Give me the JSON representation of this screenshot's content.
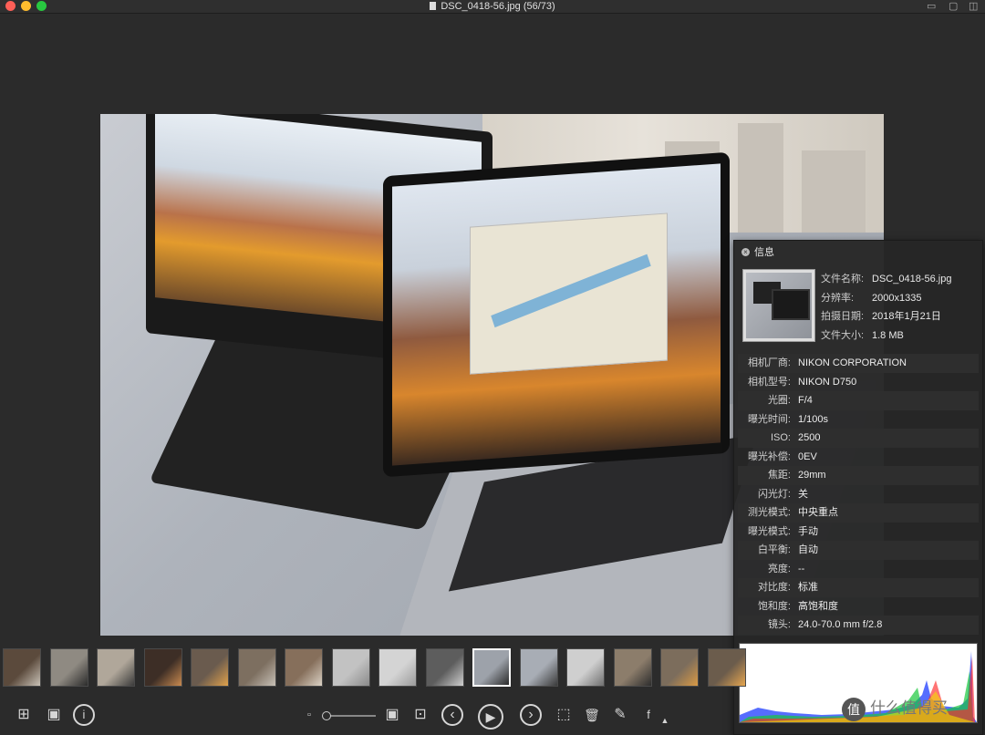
{
  "window": {
    "title": "DSC_0418-56.jpg (56/73)"
  },
  "info_panel": {
    "title": "信息",
    "basic": [
      {
        "label": "文件名称:",
        "value": "DSC_0418-56.jpg"
      },
      {
        "label": "分辨率:",
        "value": "2000x1335"
      },
      {
        "label": "拍摄日期:",
        "value": "2018年1月21日"
      },
      {
        "label": "文件大小:",
        "value": "1.8 MB"
      }
    ],
    "exif": [
      {
        "label": "相机厂商:",
        "value": "NIKON CORPORATION"
      },
      {
        "label": "相机型号:",
        "value": "NIKON D750"
      },
      {
        "label": "光圈:",
        "value": "F/4"
      },
      {
        "label": "曝光时间:",
        "value": "1/100s"
      },
      {
        "label": "ISO:",
        "value": "2500"
      },
      {
        "label": "曝光补偿:",
        "value": "0EV"
      },
      {
        "label": "焦距:",
        "value": "29mm"
      },
      {
        "label": "闪光灯:",
        "value": "关"
      },
      {
        "label": "测光模式:",
        "value": "中央重点"
      },
      {
        "label": "曝光模式:",
        "value": "手动"
      },
      {
        "label": "白平衡:",
        "value": "自动"
      },
      {
        "label": "亮度:",
        "value": "--"
      },
      {
        "label": "对比度:",
        "value": "标准"
      },
      {
        "label": "饱和度:",
        "value": "高饱和度"
      },
      {
        "label": "镜头:",
        "value": "24.0-70.0 mm f/2.8"
      }
    ],
    "watermark_badge": "值",
    "watermark_text": "什么值得买"
  },
  "filmstrip": {
    "thumbnails": [
      {
        "bg": "#5b4a3c",
        "accent": "#c9c2b7"
      },
      {
        "bg": "#8f8a82",
        "accent": "#2b2b2b"
      },
      {
        "bg": "#b0a79a",
        "accent": "#3a3a3a"
      },
      {
        "bg": "#3d2e26",
        "accent": "#c98a50"
      },
      {
        "bg": "#6a5b4e",
        "accent": "#e0a24c"
      },
      {
        "bg": "#7d6f60",
        "accent": "#c7c0b6"
      },
      {
        "bg": "#866f5b",
        "accent": "#dbd2c5"
      },
      {
        "bg": "#c2c2c2",
        "accent": "#8a8a8a"
      },
      {
        "bg": "#d4d4d4",
        "accent": "#9a9a9a"
      },
      {
        "bg": "#5d5d5d",
        "accent": "#cfcfcf"
      },
      {
        "bg": "#9da2aa",
        "accent": "#2a2a2a"
      },
      {
        "bg": "#a8adb5",
        "accent": "#3a3a3a"
      },
      {
        "bg": "#cfcfcf",
        "accent": "#6f6f6f"
      },
      {
        "bg": "#8c7d6b",
        "accent": "#2d2d2d"
      },
      {
        "bg": "#7c6d5c",
        "accent": "#d99a45"
      },
      {
        "bg": "#6b5c4c",
        "accent": "#e6a650"
      }
    ],
    "selected_index": 10
  },
  "toolbar": {
    "grid_icon": "⊞",
    "photo_icon": "▣",
    "info_icon": "i",
    "prev_icon": "‹",
    "play_icon": "▶",
    "next_icon": "›",
    "crop_icon": "⬚",
    "delete_icon": "🗑",
    "edit_icon": "✎",
    "share_icon": "f",
    "zoom_small_icon": "▫",
    "zoom_large_icon": "▣",
    "fit_icon": "⊡"
  },
  "colors": {
    "background": "#2b2b2b",
    "panel": "#262626"
  }
}
